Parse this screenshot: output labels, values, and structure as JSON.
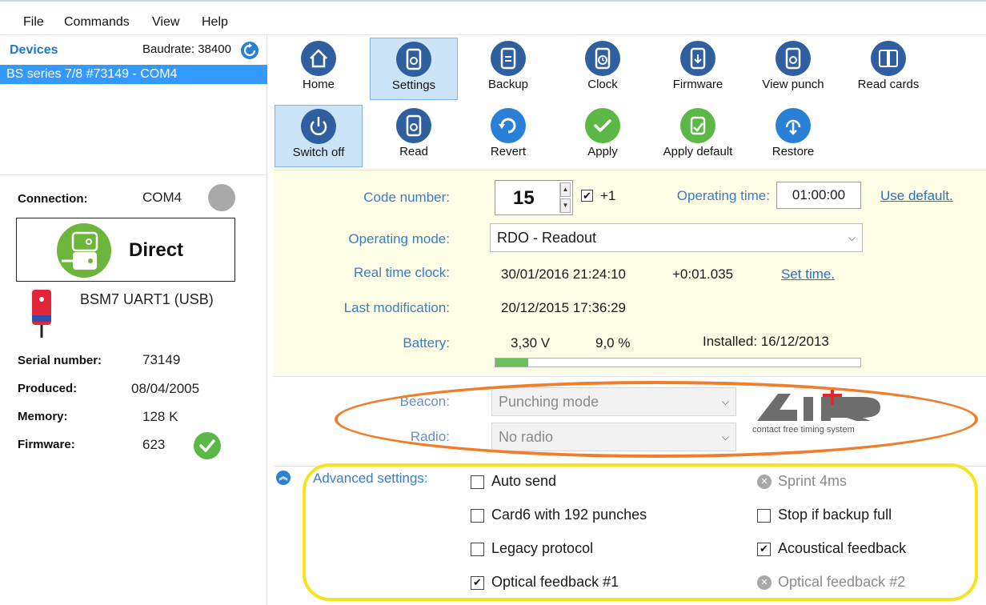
{
  "menu": {
    "file": "File",
    "commands": "Commands",
    "view": "View",
    "help": "Help"
  },
  "devices": {
    "title": "Devices",
    "baudrate": "Baudrate: 38400",
    "selected": "BS series 7/8 #73149 - COM4"
  },
  "left": {
    "connection_label": "Connection:",
    "connection_value": "COM4",
    "direct_label": "Direct",
    "bsm_label": "BSM7 UART1 (USB)",
    "serial_label": "Serial number:",
    "serial_value": "73149",
    "produced_label": "Produced:",
    "produced_value": "08/04/2005",
    "memory_label": "Memory:",
    "memory_value": "128 K",
    "firmware_label": "Firmware:",
    "firmware_value": "623"
  },
  "toolbar1": {
    "home": "Home",
    "settings": "Settings",
    "backup": "Backup",
    "clock": "Clock",
    "firmware": "Firmware",
    "view_punch": "View punch",
    "read_cards": "Read cards"
  },
  "toolbar2": {
    "switch_off": "Switch off",
    "read": "Read",
    "revert": "Revert",
    "apply": "Apply",
    "apply_default": "Apply default",
    "restore": "Restore"
  },
  "settings": {
    "code_label": "Code number:",
    "code_value": "15",
    "plus_one": "+1",
    "optime_label": "Operating time:",
    "optime_value": "01:00:00",
    "use_default": "Use default.",
    "mode_label": "Operating mode:",
    "mode_value": "RDO - Readout",
    "rtc_label": "Real time clock:",
    "rtc_value": "30/01/2016 21:24:10",
    "rtc_offset": "+0:01.035",
    "set_time": "Set time.",
    "lastmod_label": "Last modification:",
    "lastmod_value": "20/12/2015 17:36:29",
    "battery_label": "Battery:",
    "battery_voltage": "3,30 V",
    "battery_percent": "9,0 %",
    "battery_level": 0.09,
    "installed": "Installed: 16/12/2013"
  },
  "air": {
    "beacon_label": "Beacon:",
    "beacon_value": "Punching mode",
    "radio_label": "Radio:",
    "radio_value": "No radio",
    "logo_tagline": "contact free timing system"
  },
  "advanced": {
    "label": "Advanced settings:",
    "auto_send": "Auto send",
    "card6": "Card6 with 192 punches",
    "legacy": "Legacy protocol",
    "optical1": "Optical feedback #1",
    "sprint": "Sprint 4ms",
    "stop_backup": "Stop if backup full",
    "acoustical": "Acoustical feedback",
    "optical2": "Optical feedback #2"
  },
  "colors": {
    "accent": "#3399ff",
    "label_blue": "#3a7cc0",
    "ok_green": "#5bb746",
    "orange": "#f07d2a",
    "yellow": "#f5e31d"
  }
}
